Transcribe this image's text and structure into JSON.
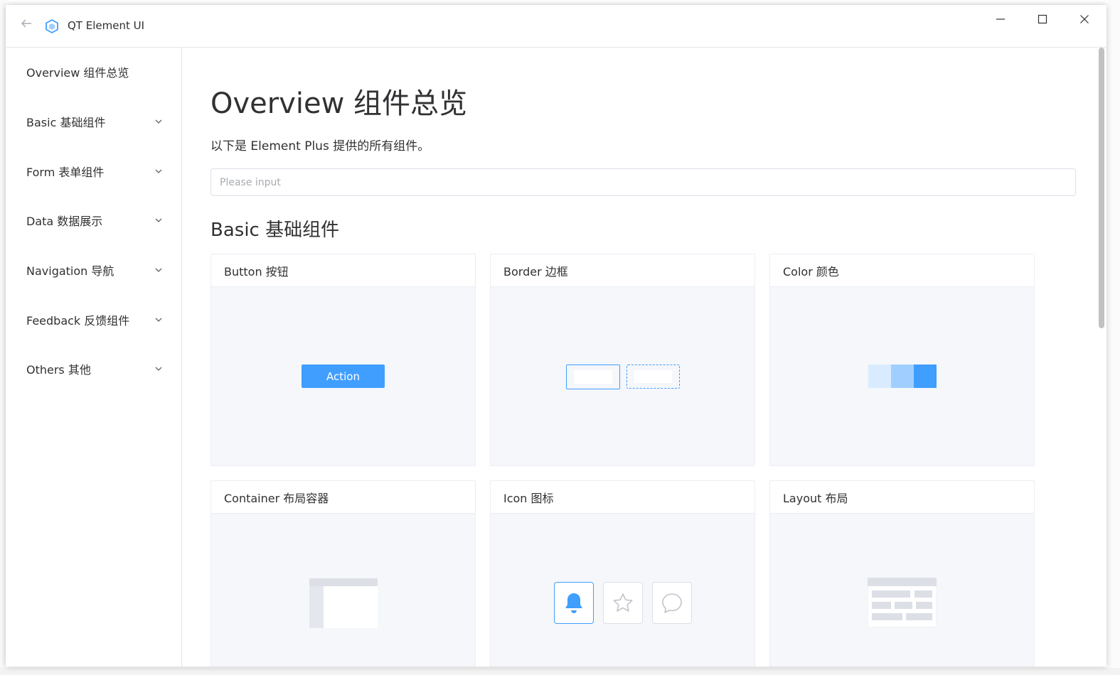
{
  "window": {
    "title": "QT Element UI"
  },
  "sidebar": {
    "items": [
      {
        "label": "Overview 组件总览",
        "has_children": false
      },
      {
        "label": "Basic 基础组件",
        "has_children": true
      },
      {
        "label": "Form 表单组件",
        "has_children": true
      },
      {
        "label": "Data 数据展示",
        "has_children": true
      },
      {
        "label": "Navigation 导航",
        "has_children": true
      },
      {
        "label": "Feedback 反馈组件",
        "has_children": true
      },
      {
        "label": "Others 其他",
        "has_children": true
      }
    ]
  },
  "main": {
    "title": "Overview 组件总览",
    "description": "以下是 Element Plus 提供的所有组件。",
    "search": {
      "placeholder": "Please input",
      "value": ""
    },
    "section_title": "Basic 基础组件",
    "cards": [
      {
        "title": "Button 按钮",
        "demo": {
          "button_label": "Action"
        }
      },
      {
        "title": "Border 边框"
      },
      {
        "title": "Color 颜色",
        "demo": {
          "swatches": [
            "#d9ecff",
            "#a0cfff",
            "#409eff"
          ]
        }
      },
      {
        "title": "Container 布局容器"
      },
      {
        "title": "Icon 图标"
      },
      {
        "title": "Layout 布局"
      }
    ]
  },
  "colors": {
    "accent": "#409eff",
    "text": "#303133",
    "border": "#dcdfe6",
    "card_bg": "#f5f7fa"
  }
}
